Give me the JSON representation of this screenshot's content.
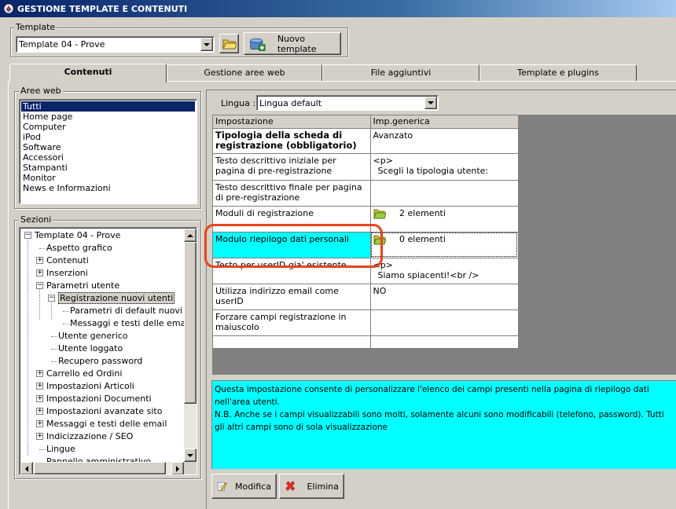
{
  "window": {
    "title": "GESTIONE TEMPLATE E CONTENUTI"
  },
  "template_group": {
    "label": "Template",
    "selected": "Template 04 - Prove",
    "new_button_label": "Nuovo template"
  },
  "tabs": [
    "Contenuti",
    "Gestione aree web",
    "File aggiuntivi",
    "Template e plugins"
  ],
  "aree_web": {
    "label": "Aree web",
    "items": [
      "Tutti",
      "Home page",
      "Computer",
      "iPod",
      "Software",
      "Accessori",
      "Stampanti",
      "Monitor",
      "News e Informazioni"
    ]
  },
  "sezioni": {
    "label": "Sezioni",
    "tree": [
      "Template 04 - Prove",
      "Aspetto grafico",
      "Contenuti",
      "Inserzioni",
      "Parametri utente",
      "Registrazione nuovi utenti",
      "Parametri di default nuovi utenti",
      "Messaggi e testi delle email",
      "Utente generico",
      "Utente loggato",
      "Recupero password",
      "Carrello ed Ordini",
      "Impostazioni Articoli",
      "Impostazioni Documenti",
      "Impostazioni avanzate sito",
      "Messaggi e testi delle email",
      "Indicizzazione / SEO",
      "Lingue",
      "Pannello amministrativo"
    ]
  },
  "lingua": {
    "label": "Lingua :",
    "selected": "Lingua default"
  },
  "grid": {
    "headers": [
      "Impostazione",
      "Imp.generica"
    ],
    "rows": [
      {
        "setting": "Tipologia della scheda di registrazione (obbligatorio)",
        "value": "Avanzato",
        "bold": true
      },
      {
        "setting": "Testo descrittivo iniziale per pagina di pre-registrazione",
        "value": "<p>",
        "value2": "Scegli la tipologia utente:"
      },
      {
        "setting": "Testo descrittivo finale per pagina di pre-registrazione",
        "value": ""
      },
      {
        "setting": "Moduli di registrazione",
        "value": "2 elementi",
        "icon": "folder-icon"
      },
      {
        "setting": "Modulo riepilogo dati personali",
        "value": "0 elementi",
        "icon": "folder-icon",
        "selected": true
      },
      {
        "setting": "Testo per userID gia' esistente",
        "value": "<p>",
        "value2": "Siamo spiacenti!<br />"
      },
      {
        "setting": "Utilizza indirizzo email come userID",
        "value": "NO"
      },
      {
        "setting": "Forzare campi registrazione in maiuscolo",
        "value": ""
      },
      {
        "setting": "",
        "value": ""
      }
    ]
  },
  "description": "Questa impostazione consente di personalizzare l'elenco dei campi presenti nella pagina di riepilogo dati nell'area utenti.\nN.B. Anche se i campi visualizzabili sono molti, solamente alcuni sono modificabili (telefono, password). Tutti gli altri campi sono di sola visualizzazione",
  "buttons": {
    "modifica": "Modifica",
    "elimina": "Elimina"
  },
  "colors": {
    "highlight": "#00ffff",
    "annotation": "#e8441c",
    "selection": "#0a246a"
  }
}
